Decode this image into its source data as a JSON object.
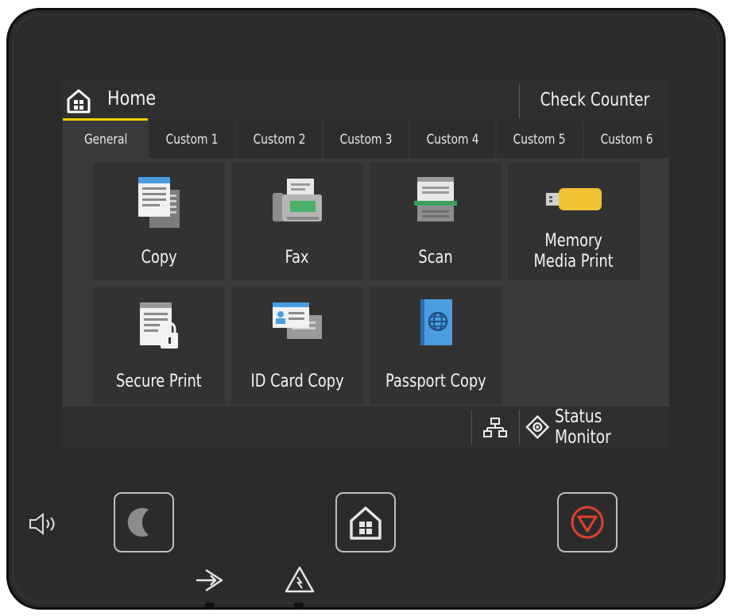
{
  "header": {
    "home_label": "Home",
    "check_counter_label": "Check Counter"
  },
  "tabs": [
    {
      "label": "General",
      "active": true
    },
    {
      "label": "Custom 1",
      "active": false
    },
    {
      "label": "Custom 2",
      "active": false
    },
    {
      "label": "Custom 3",
      "active": false
    },
    {
      "label": "Custom 4",
      "active": false
    },
    {
      "label": "Custom 5",
      "active": false
    },
    {
      "label": "Custom 6",
      "active": false
    }
  ],
  "tiles": [
    {
      "label": "Copy",
      "icon": "copy-icon"
    },
    {
      "label": "Fax",
      "icon": "fax-icon"
    },
    {
      "label": "Scan",
      "icon": "scan-icon"
    },
    {
      "label": "Memory\nMedia Print",
      "icon": "usb-memory-icon"
    },
    {
      "label": "Secure Print",
      "icon": "secure-print-icon"
    },
    {
      "label": "ID Card Copy",
      "icon": "id-card-icon"
    },
    {
      "label": "Passport Copy",
      "icon": "passport-icon"
    }
  ],
  "footer": {
    "status_monitor_label": "Status Monitor"
  },
  "colors": {
    "accent_tab": "#ffd200",
    "stop_red": "#e0402a",
    "panel": "#2b2b2c"
  },
  "hardware": {
    "buttons": [
      "energy-saver-button",
      "home-button",
      "stop-button"
    ],
    "icons": [
      "speaker-icon",
      "data-in-icon",
      "error-warning-icon"
    ]
  }
}
